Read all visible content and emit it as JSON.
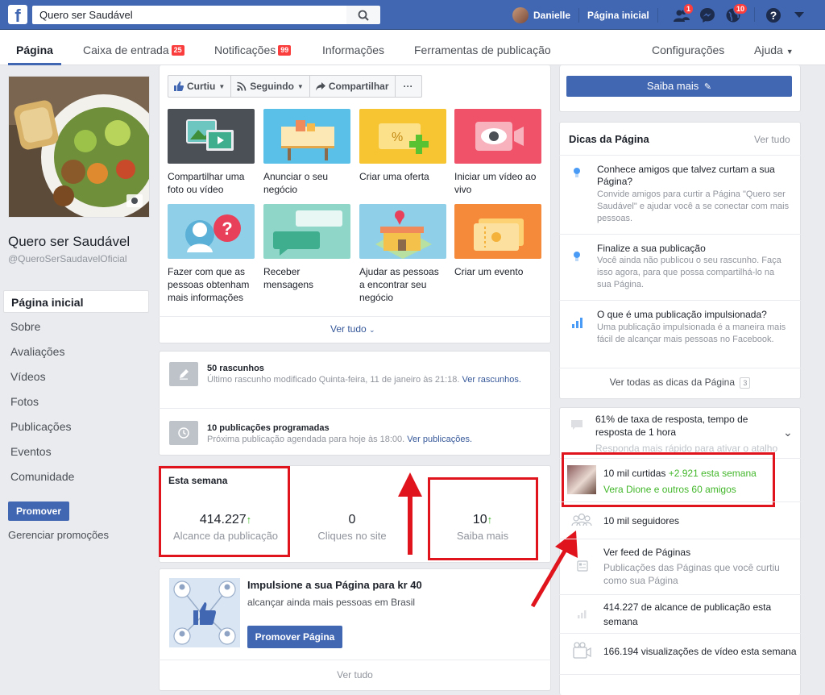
{
  "topbar": {
    "search_value": "Quero ser Saudável",
    "user_name": "Danielle",
    "home_label": "Página inicial",
    "friends_badge": "1",
    "notif_badge": "10"
  },
  "tabs": {
    "pagina": "Página",
    "caixa": "Caixa de entrada",
    "caixa_badge": "25",
    "notificacoes": "Notificações",
    "notificacoes_badge": "99",
    "informacoes": "Informações",
    "ferramentas": "Ferramentas de publicação",
    "configuracoes": "Configurações",
    "ajuda": "Ajuda"
  },
  "page": {
    "name": "Quero ser Saudável",
    "handle": "@QueroSerSaudavelOficial"
  },
  "left_nav": [
    "Página inicial",
    "Sobre",
    "Avaliações",
    "Vídeos",
    "Fotos",
    "Publicações",
    "Eventos",
    "Comunidade"
  ],
  "promote": {
    "button": "Promover",
    "manage": "Gerenciar promoções"
  },
  "actions": {
    "curtiu": "Curtiu",
    "seguindo": "Seguindo",
    "compartilhar": "Compartilhar",
    "more": "···",
    "saiba_mais": "Saiba mais"
  },
  "tiles": [
    {
      "label": "Compartilhar uma foto ou vídeo"
    },
    {
      "label": "Anunciar o seu negócio"
    },
    {
      "label": "Criar uma oferta"
    },
    {
      "label": "Iniciar um vídeo ao vivo"
    },
    {
      "label": "Fazer com que as pessoas obtenham mais informações"
    },
    {
      "label": "Receber mensagens"
    },
    {
      "label": "Ajudar as pessoas a encontrar seu negócio"
    },
    {
      "label": "Criar um evento"
    }
  ],
  "ver_tudo": "Ver tudo",
  "drafts": {
    "title": "50 rascunhos",
    "desc": "Último rascunho modificado Quinta-feira, 11 de janeiro às 21:18.",
    "link": "Ver rascunhos."
  },
  "scheduled": {
    "title": "10 publicações programadas",
    "desc": "Próxima publicação agendada para hoje às 18:00.",
    "link": "Ver publicações."
  },
  "week": {
    "title": "Esta semana",
    "reach_value": "414.227",
    "reach_label": "Alcance da publicação",
    "clicks_value": "0",
    "clicks_label": "Cliques no site",
    "saiba_value": "10",
    "saiba_label": "Saiba mais"
  },
  "boost": {
    "title": "Impulsione a sua Página para kr 40",
    "desc": "alcançar ainda mais pessoas em Brasil",
    "button": "Promover Página",
    "ver_tudo": "Ver tudo"
  },
  "tips": {
    "title": "Dicas da Página",
    "ver_tudo": "Ver tudo",
    "items": [
      {
        "title": "Conhece amigos que talvez curtam a sua Página?",
        "desc": "Convide amigos para curtir a Página \"Quero ser Saudável\" e ajudar você a se conectar com mais pessoas."
      },
      {
        "title": "Finalize a sua publicação",
        "desc": "Você ainda não publicou o seu rascunho. Faça isso agora, para que possa compartilhá-lo na sua Página."
      },
      {
        "title": "O que é uma publicação impulsionada?",
        "desc": "Uma publicação impulsionada é a maneira mais fácil de alcançar mais pessoas no Facebook."
      }
    ],
    "all_link": "Ver todas as dicas da Página",
    "all_count": "3"
  },
  "stats": {
    "response": "61% de taxa de resposta, tempo de resposta de 1 hora",
    "response_hint": "Responda mais rápido para ativar o atalho",
    "likes": "10 mil curtidas",
    "likes_week": "+2.921 esta semana",
    "likes_friend": "Vera Dione",
    "likes_others": "e outros 60 amigos",
    "followers": "10 mil seguidores",
    "feed_title": "Ver feed de Páginas",
    "feed_desc": "Publicações das Páginas que você curtiu como sua Página",
    "reach": "414.227 de alcance de publicação esta semana",
    "video": "166.194 visualizações de vídeo esta semana"
  },
  "colors": {
    "brand": "#4267b2",
    "highlight": "#e0141c",
    "positive": "#42b72a"
  }
}
